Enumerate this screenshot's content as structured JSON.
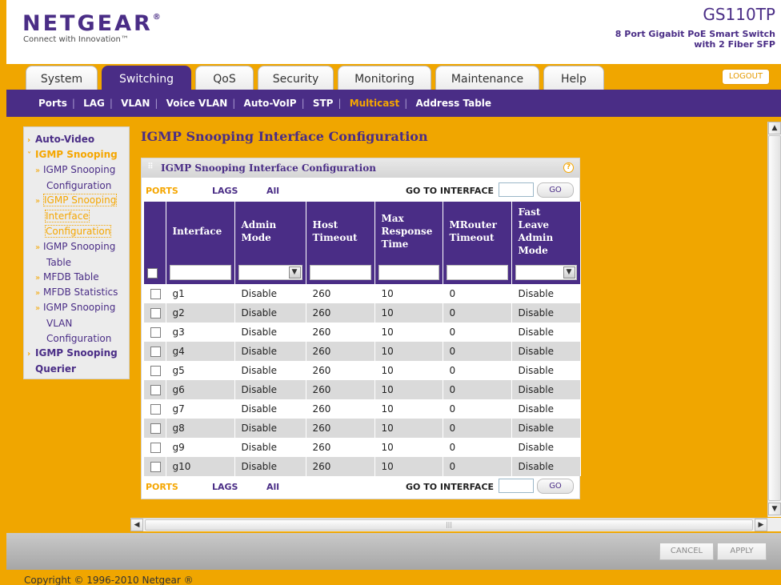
{
  "header": {
    "logo": "NETGEAR",
    "logo_mark": "®",
    "tagline": "Connect with Innovation™",
    "model": "GS110TP",
    "model_desc_1": "8 Port Gigabit PoE Smart Switch",
    "model_desc_2": "with 2 Fiber SFP",
    "logout": "LOGOUT"
  },
  "tabs": [
    "System",
    "Switching",
    "QoS",
    "Security",
    "Monitoring",
    "Maintenance",
    "Help"
  ],
  "active_tab": "Switching",
  "subnav": [
    "Ports",
    "LAG",
    "VLAN",
    "Voice VLAN",
    "Auto-VoIP",
    "STP",
    "Multicast",
    "Address Table"
  ],
  "active_subnav": "Multicast",
  "menu": {
    "auto_video": "Auto-Video",
    "igmp_snooping": "IGMP Snooping",
    "igmp_cfg_1": "IGMP Snooping",
    "igmp_cfg_2": "Configuration",
    "igmp_if_1": "IGMP Snooping",
    "igmp_if_2": "Interface",
    "igmp_if_3": "Configuration",
    "igmp_table_1": "IGMP Snooping",
    "igmp_table_2": "Table",
    "mfdb_table": "MFDB Table",
    "mfdb_stats": "MFDB Statistics",
    "igmp_vlan_1": "IGMP Snooping",
    "igmp_vlan_2": "VLAN",
    "igmp_vlan_3": "Configuration",
    "querier_1": "IGMP Snooping",
    "querier_2": "Querier"
  },
  "page": {
    "title": "IGMP Snooping Interface Configuration",
    "panel_title": "IGMP Snooping Interface Configuration",
    "help": "?"
  },
  "linkbar": {
    "ports": "PORTS",
    "lags": "LAGS",
    "all": "All",
    "goto": "GO TO INTERFACE",
    "go": "GO"
  },
  "table": {
    "columns": [
      "Interface",
      "Admin Mode",
      "Host Timeout",
      "Max Response Time",
      "MRouter Timeout",
      "Fast Leave Admin Mode"
    ],
    "rows": [
      [
        "g1",
        "Disable",
        "260",
        "10",
        "0",
        "Disable"
      ],
      [
        "g2",
        "Disable",
        "260",
        "10",
        "0",
        "Disable"
      ],
      [
        "g3",
        "Disable",
        "260",
        "10",
        "0",
        "Disable"
      ],
      [
        "g4",
        "Disable",
        "260",
        "10",
        "0",
        "Disable"
      ],
      [
        "g5",
        "Disable",
        "260",
        "10",
        "0",
        "Disable"
      ],
      [
        "g6",
        "Disable",
        "260",
        "10",
        "0",
        "Disable"
      ],
      [
        "g7",
        "Disable",
        "260",
        "10",
        "0",
        "Disable"
      ],
      [
        "g8",
        "Disable",
        "260",
        "10",
        "0",
        "Disable"
      ],
      [
        "g9",
        "Disable",
        "260",
        "10",
        "0",
        "Disable"
      ],
      [
        "g10",
        "Disable",
        "260",
        "10",
        "0",
        "Disable"
      ]
    ]
  },
  "buttons": {
    "cancel": "CANCEL",
    "apply": "APPLY"
  },
  "footer": {
    "copyright": "Copyright © 1996-2010 Netgear ®"
  },
  "colors": {
    "brand_purple": "#4a2d86",
    "accent_orange": "#f5a600"
  }
}
